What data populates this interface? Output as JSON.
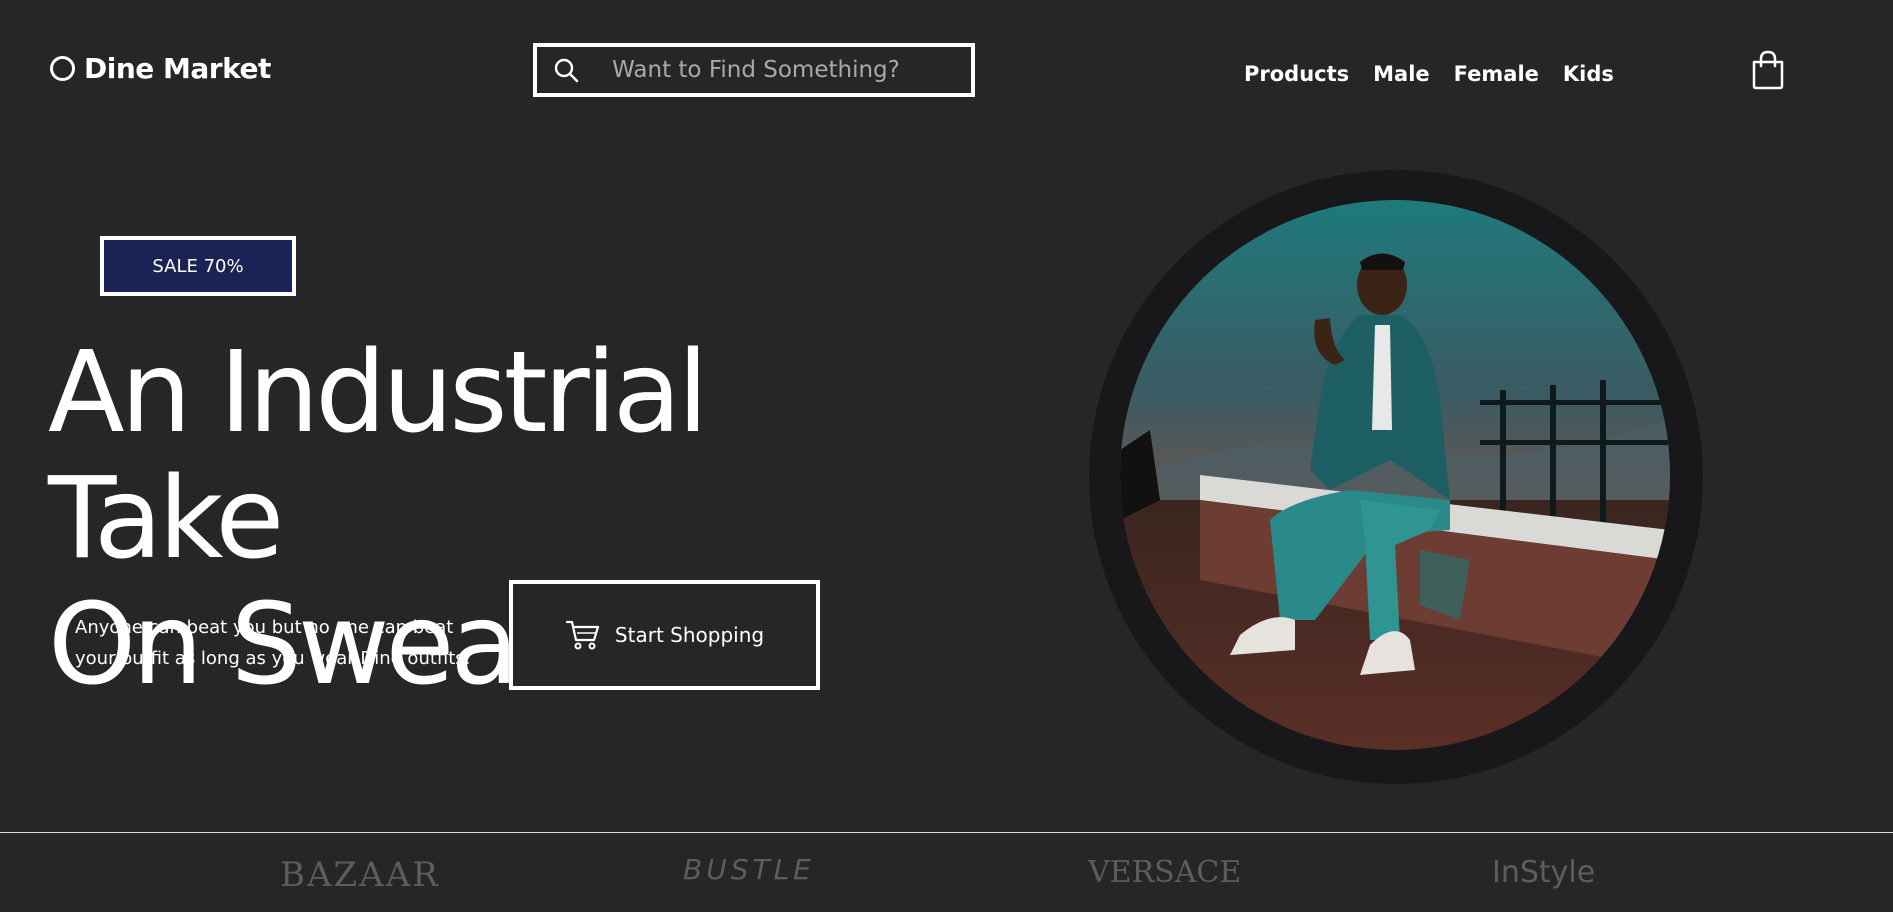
{
  "header": {
    "logo_text": "Dine Market",
    "search_placeholder": "Want to Find Something?",
    "nav": [
      "Products",
      "Male",
      "Female",
      "Kids"
    ]
  },
  "hero": {
    "badge": "SALE 70%",
    "headline_line1": "An Industrial Take",
    "headline_line2": "On Sweaters",
    "tagline_line1": "Anyone can beat you but no one can beat",
    "tagline_line2": "your outfit as long as you wear Dine outfits.",
    "cta_label": "Start Shopping"
  },
  "brands": [
    "BAZAAR",
    "BUSTLE",
    "VERSACE",
    "InStyle"
  ],
  "colors": {
    "background": "#262628",
    "badge_background": "#1a2355",
    "brand_logo": "#5d5d60"
  },
  "icons": {
    "logo": "logo-circle-icon",
    "search": "search-icon",
    "cart": "shopping-bag-icon",
    "cta": "cart-icon"
  }
}
